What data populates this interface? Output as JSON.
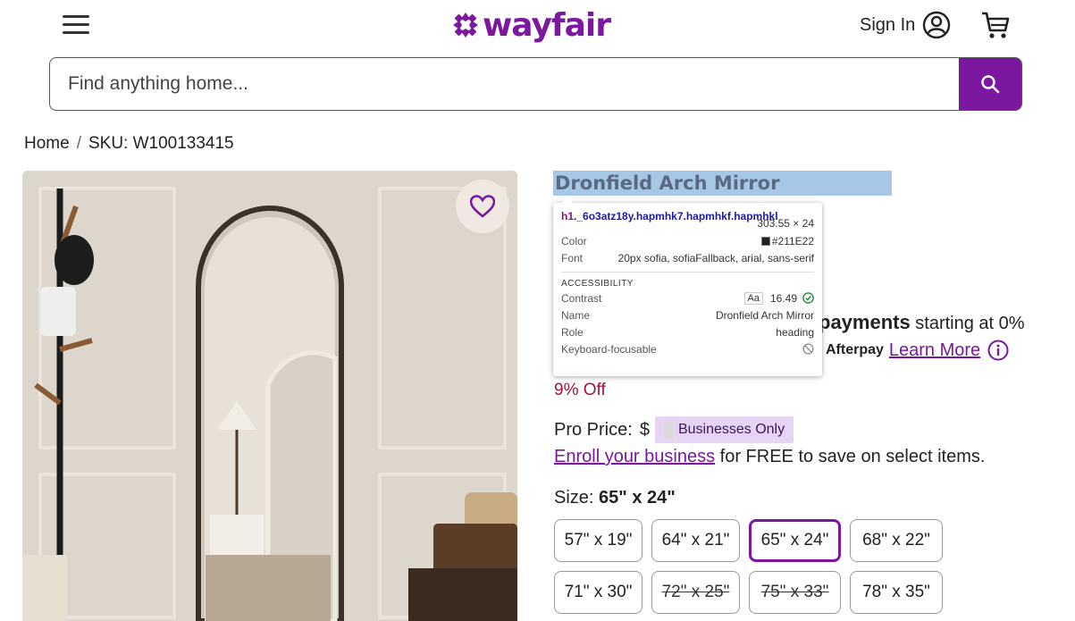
{
  "header": {
    "logo_text": "wayfair",
    "signin_label": "Sign In",
    "brand_color": "#7B189F"
  },
  "search": {
    "placeholder": "Find anything home..."
  },
  "breadcrumb": {
    "home": "Home",
    "separator": "/",
    "sku": "SKU: W100133415"
  },
  "product": {
    "title": "Dronfield Arch Mirror",
    "payments_bold": "payments",
    "payments_rest": "starting at 0%",
    "afterpay": "Afterpay",
    "learn_more": "Learn More",
    "discount": "9% Off",
    "pro_price_label": "Pro Price:",
    "pro_price_dollar": "$",
    "businesses_only": "Businesses Only",
    "enroll_link": "Enroll your business",
    "enroll_rest": "for FREE to save on select items.",
    "size_label": "Size:",
    "size_selected": "65\" x 24\"",
    "sizes": [
      {
        "label": "57\" x 19\"",
        "state": "available"
      },
      {
        "label": "64\" x 21\"",
        "state": "available"
      },
      {
        "label": "65\" x 24\"",
        "state": "selected"
      },
      {
        "label": "68\" x 22\"",
        "state": "available"
      },
      {
        "label": "71\" x 30\"",
        "state": "available"
      },
      {
        "label": "72\" x 25\"",
        "state": "unavailable"
      },
      {
        "label": "75\" x 33\"",
        "state": "unavailable"
      },
      {
        "label": "78\" x 35\"",
        "state": "available"
      }
    ]
  },
  "devtools_tooltip": {
    "selector_tag": "h1",
    "selector_class": "._6o3atz18y.hapmhk7.hapmhkf.hapmhkl",
    "dimensions": "303.55 × 24",
    "color_label": "Color",
    "color_value": "#211E22",
    "font_label": "Font",
    "font_value": "20px sofia, sofiaFallback, arial, sans-serif",
    "accessibility_header": "ACCESSIBILITY",
    "contrast_label": "Contrast",
    "contrast_aa": "Aa",
    "contrast_value": "16.49",
    "name_label": "Name",
    "name_value": "Dronfield Arch Mirror",
    "role_label": "Role",
    "role_value": "heading",
    "keyboard_label": "Keyboard-focusable"
  },
  "icons": {
    "menu": "hamburger-menu-icon",
    "account": "account-circle-icon",
    "cart": "shopping-cart-icon",
    "search": "search-icon",
    "favorite": "heart-icon",
    "info": "info-icon"
  }
}
